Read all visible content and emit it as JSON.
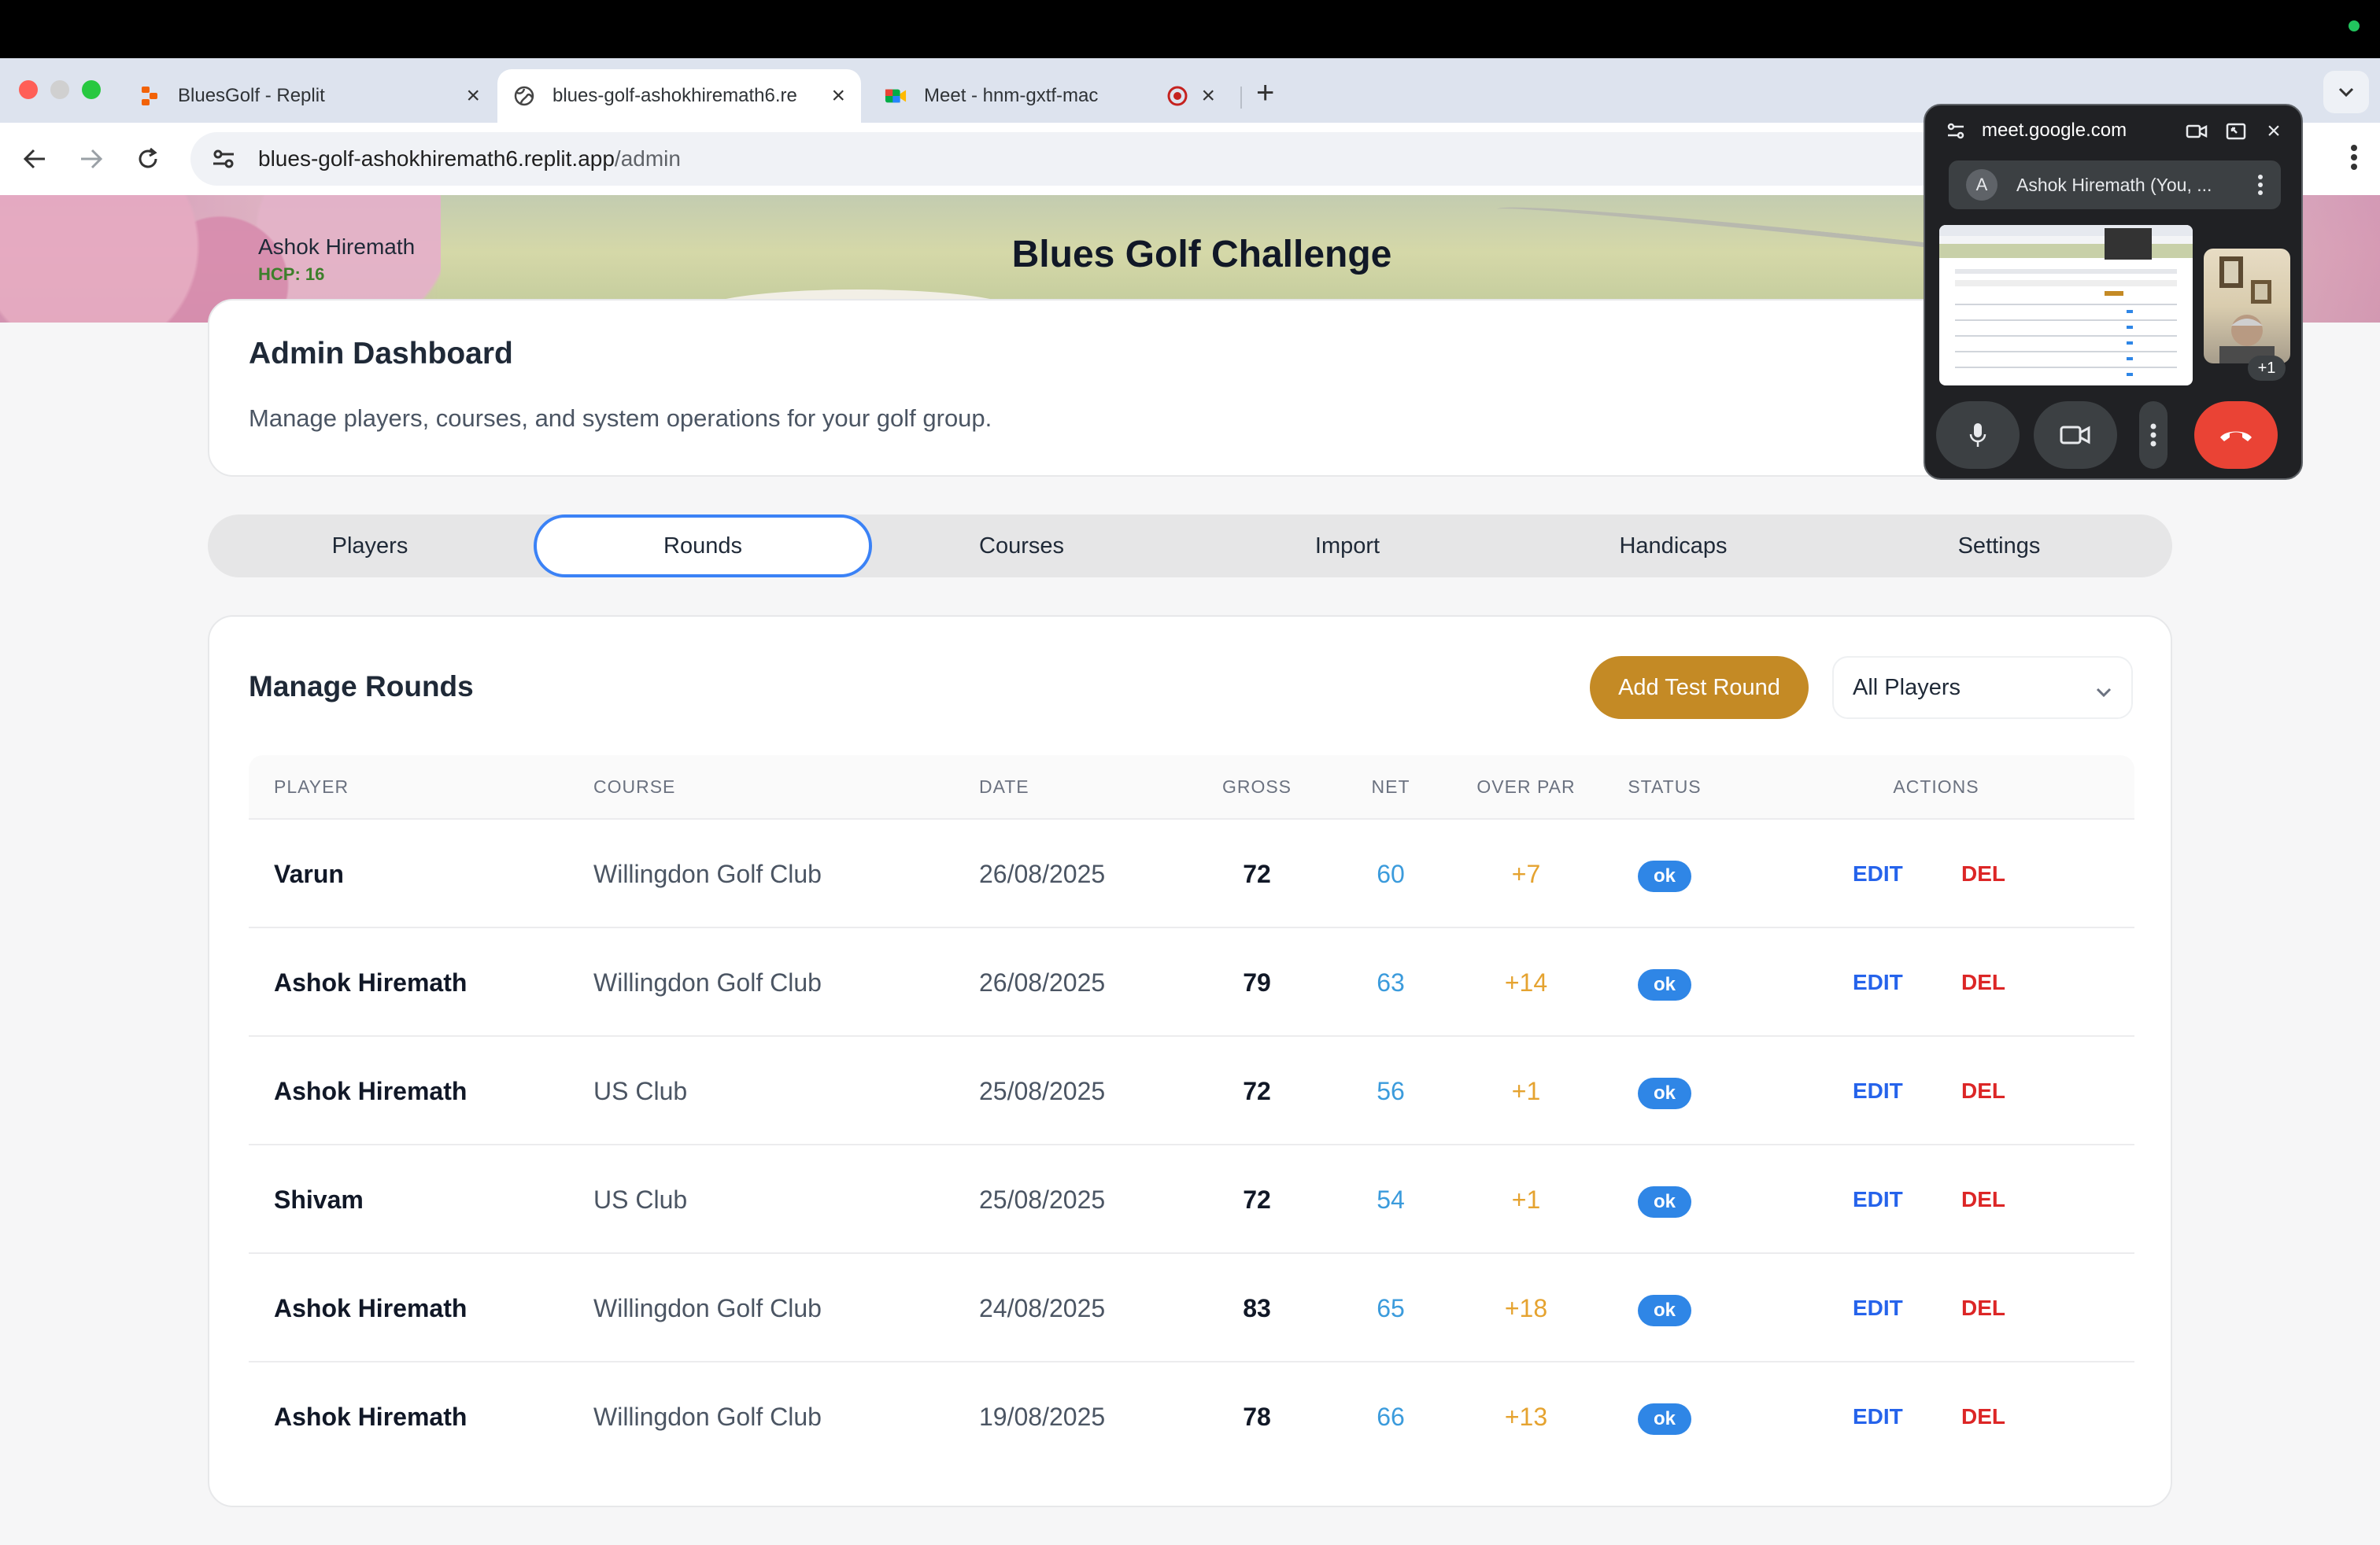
{
  "browser": {
    "tabs": [
      {
        "label": "BluesGolf - Replit",
        "favicon": "replit-icon"
      },
      {
        "label": "blues-golf-ashokhiremath6.re",
        "favicon": "globe-icon"
      },
      {
        "label": "Meet - hnm-gxtf-mac",
        "favicon": "meet-icon"
      }
    ],
    "url_host": "blues-golf-ashokhiremath6.replit.app",
    "url_path": "/admin"
  },
  "header": {
    "user_name": "Ashok Hiremath",
    "handicap": "HCP: 16",
    "title": "Blues Golf Challenge"
  },
  "admin": {
    "title": "Admin Dashboard",
    "subtitle": "Manage players, courses, and system operations for your golf group."
  },
  "nav_tabs": [
    "Players",
    "Rounds",
    "Courses",
    "Import",
    "Handicaps",
    "Settings"
  ],
  "selected_tab": "Rounds",
  "rounds": {
    "title": "Manage Rounds",
    "add_button": "Add Test Round",
    "filter_value": "All Players",
    "columns": [
      "PLAYER",
      "COURSE",
      "DATE",
      "GROSS",
      "NET",
      "OVER PAR",
      "STATUS",
      "ACTIONS"
    ],
    "edit_label": "EDIT",
    "delete_label": "DEL",
    "rows": [
      {
        "player": "Varun",
        "course": "Willingdon Golf Club",
        "date": "26/08/2025",
        "gross": "72",
        "net": "60",
        "over_par": "+7",
        "status": "ok"
      },
      {
        "player": "Ashok Hiremath",
        "course": "Willingdon Golf Club",
        "date": "26/08/2025",
        "gross": "79",
        "net": "63",
        "over_par": "+14",
        "status": "ok"
      },
      {
        "player": "Ashok Hiremath",
        "course": "US Club",
        "date": "25/08/2025",
        "gross": "72",
        "net": "56",
        "over_par": "+1",
        "status": "ok"
      },
      {
        "player": "Shivam",
        "course": "US Club",
        "date": "25/08/2025",
        "gross": "72",
        "net": "54",
        "over_par": "+1",
        "status": "ok"
      },
      {
        "player": "Ashok Hiremath",
        "course": "Willingdon Golf Club",
        "date": "24/08/2025",
        "gross": "83",
        "net": "65",
        "over_par": "+18",
        "status": "ok"
      },
      {
        "player": "Ashok Hiremath",
        "course": "Willingdon Golf Club",
        "date": "19/08/2025",
        "gross": "78",
        "net": "66",
        "over_par": "+13",
        "status": "ok"
      }
    ]
  },
  "meet_pip": {
    "domain": "meet.google.com",
    "participant_initial": "A",
    "participant_name": "Ashok Hiremath (You, ...",
    "extra_count": "+1"
  },
  "colors": {
    "accent": "#3b82f6",
    "add_button": "#c48a25",
    "net": "#3b9bdc",
    "over_par": "#e5a330",
    "edit": "#2563eb",
    "delete": "#dc2626",
    "status_badge": "#2f86e6"
  }
}
